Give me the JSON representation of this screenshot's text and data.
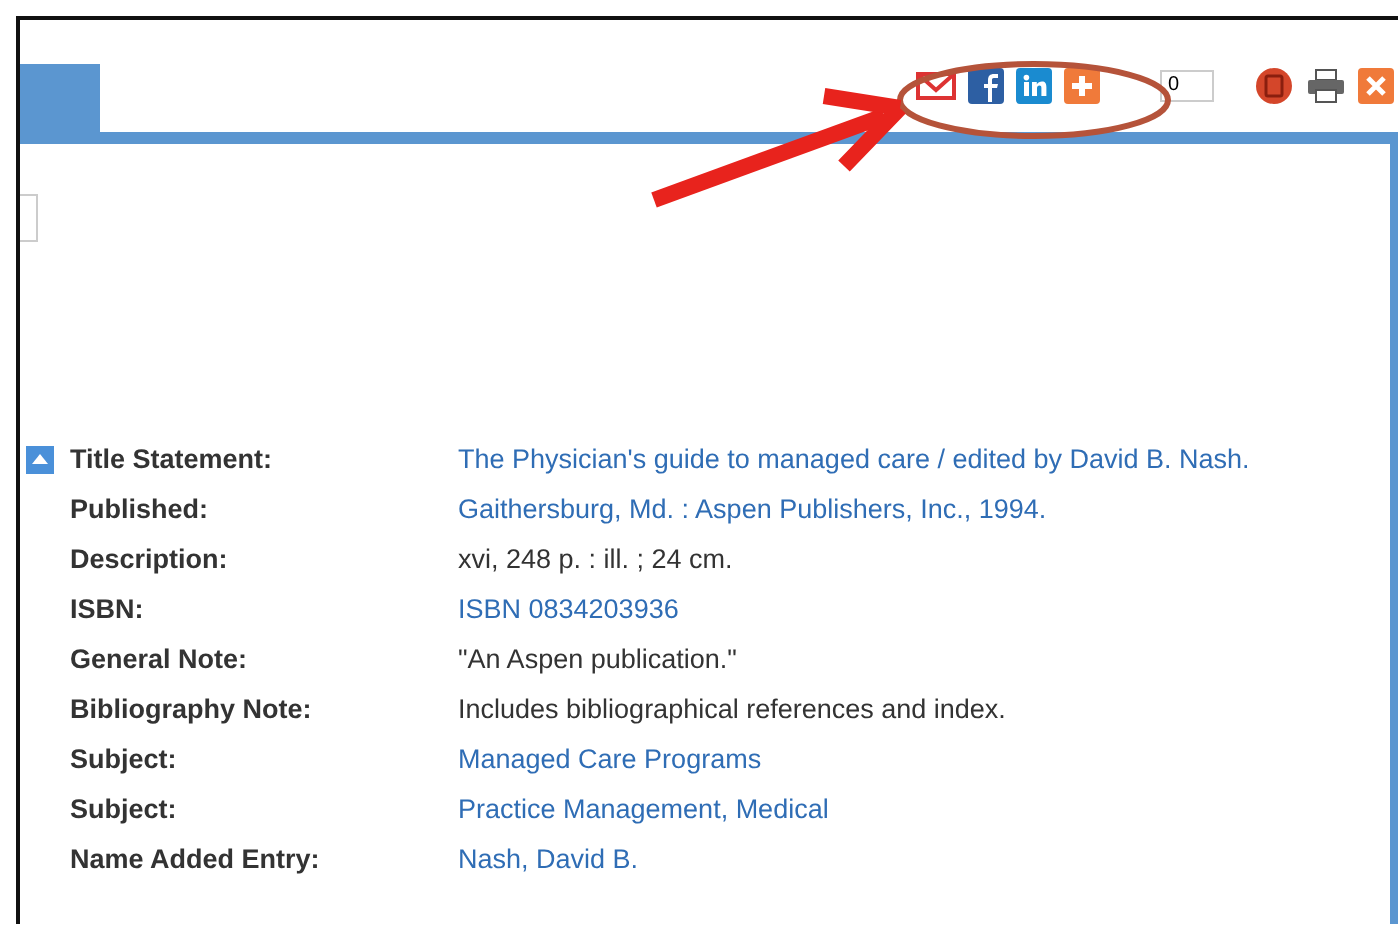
{
  "toolbar": {
    "share_count": "0"
  },
  "record": {
    "expanded": true,
    "fields": [
      {
        "label": "Title Statement:",
        "value": "The Physician's guide to managed care / edited by David B. Nash.",
        "kind": "link"
      },
      {
        "label": "Published:",
        "value": "Gaithersburg, Md. : Aspen Publishers, Inc., 1994.",
        "kind": "link"
      },
      {
        "label": "Description:",
        "value": "xvi, 248 p. : ill. ; 24 cm.",
        "kind": "text"
      },
      {
        "label": "ISBN:",
        "value": "ISBN 0834203936",
        "kind": "link"
      },
      {
        "label": "General Note:",
        "value": "\"An Aspen publication.\"",
        "kind": "text"
      },
      {
        "label": "Bibliography Note:",
        "value": "Includes bibliographical references and index.",
        "kind": "text"
      },
      {
        "label": "Subject:",
        "value": "Managed Care Programs",
        "kind": "link"
      },
      {
        "label": "Subject:",
        "value": "Practice Management, Medical",
        "kind": "link"
      },
      {
        "label": "Name Added Entry:",
        "value": "Nash, David B.",
        "kind": "link"
      }
    ]
  }
}
